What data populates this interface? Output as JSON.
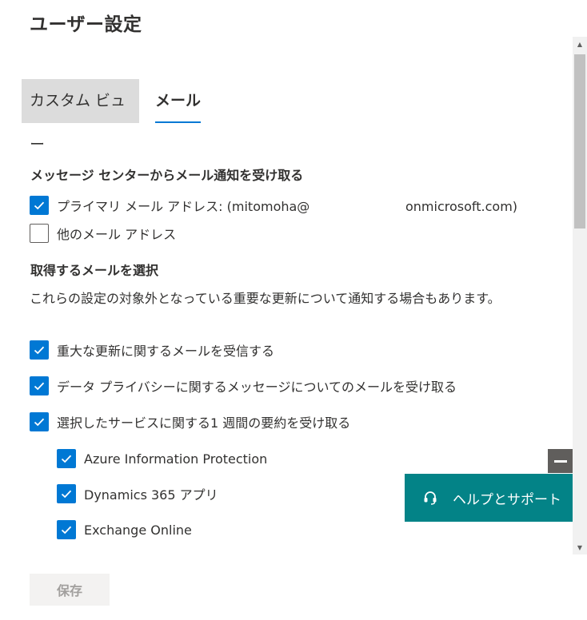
{
  "page": {
    "title": "ユーザー設定"
  },
  "tabs": [
    {
      "label": "カスタム ビュー"
    },
    {
      "label": "メール"
    }
  ],
  "section_message_center": {
    "heading": "メッセージ センターからメール通知を受け取る",
    "primary_email": {
      "label": "プライマリ メール アドレス: (mitomoha@",
      "domain": "onmicrosoft.com)",
      "checked": true
    },
    "other_email": {
      "label": "他のメール アドレス",
      "checked": false
    }
  },
  "section_select": {
    "heading": "取得するメールを選択",
    "description": "これらの設定の対象外となっている重要な更新について通知する場合もあります。",
    "options": [
      {
        "label": "重大な更新に関するメールを受信する",
        "checked": true
      },
      {
        "label": "データ プライバシーに関するメッセージについてのメールを受け取る",
        "checked": true
      },
      {
        "label": "選択したサービスに関する1 週間の要約を受け取る",
        "checked": true
      }
    ],
    "services": [
      {
        "label": "Azure Information Protection",
        "checked": true
      },
      {
        "label": "Dynamics 365 アプリ",
        "checked": true
      },
      {
        "label": "Exchange Online",
        "checked": true
      }
    ]
  },
  "help": {
    "label": "ヘルプとサポート",
    "icon": "headset-icon",
    "accent": "#038387"
  },
  "footer": {
    "save_label": "保存"
  },
  "colors": {
    "checkbox": "#0078d4",
    "tab_underline": "#0078d4"
  }
}
